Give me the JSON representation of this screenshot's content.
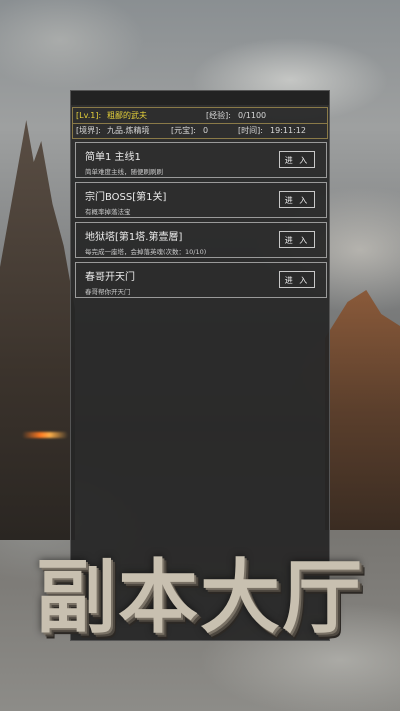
{
  "status": {
    "level_text": "[Lv.1]:",
    "player_name": "粗鄙的武夫",
    "exp_label": "[经验]:",
    "exp_value": "0/1100",
    "realm_label": "[境界]:",
    "realm_value": "九品.炼精境",
    "yuanbao_label": "[元宝]:",
    "yuanbao_value": "0",
    "time_label": "[时间]:",
    "time_value": "19:11:12"
  },
  "dungeons": [
    {
      "title": "简单1 主线1",
      "desc": "简单难度主线，随便刷刷刷",
      "button": "进 入"
    },
    {
      "title": "宗门BOSS[第1关]",
      "desc": "有概率掉落法宝",
      "button": "进 入"
    },
    {
      "title": "地狱塔[第1塔.第壹層]",
      "desc": "每完成一座塔，会掉落英魂(次数：10/10)",
      "button": "进 入"
    },
    {
      "title": "春哥开天门",
      "desc": "春哥帮你开天门",
      "button": "进 入"
    }
  ],
  "banner": {
    "title": "副本大厅"
  },
  "colors": {
    "accent_yellow": "#e7d23a",
    "panel_bg": "#262626",
    "border_gold": "#8a7a48"
  }
}
